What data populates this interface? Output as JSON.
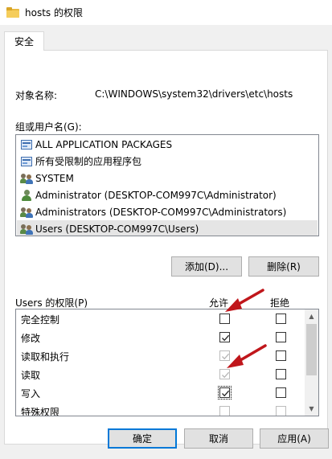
{
  "window": {
    "title": "hosts 的权限",
    "icon": "folder-icon"
  },
  "tabs": [
    {
      "label": "安全",
      "active": true
    }
  ],
  "object": {
    "label": "对象名称:",
    "value": "C:\\WINDOWS\\system32\\drivers\\etc\\hosts"
  },
  "groups": {
    "label": "组或用户名(G):",
    "items": [
      {
        "name": "ALL APPLICATION PACKAGES",
        "icon": "package-icon",
        "selected": false
      },
      {
        "name": "所有受限制的应用程序包",
        "icon": "package-icon",
        "selected": false
      },
      {
        "name": "SYSTEM",
        "icon": "group-icon",
        "selected": false
      },
      {
        "name": "Administrator (DESKTOP-COM997C\\Administrator)",
        "icon": "user-icon",
        "selected": false
      },
      {
        "name": "Administrators (DESKTOP-COM997C\\Administrators)",
        "icon": "group-icon",
        "selected": false
      },
      {
        "name": "Users (DESKTOP-COM997C\\Users)",
        "icon": "group-icon",
        "selected": true
      }
    ],
    "add_button": "添加(D)...",
    "remove_button": "删除(R)"
  },
  "permissions": {
    "label": "Users 的权限(P)",
    "allow_header": "允许",
    "deny_header": "拒绝",
    "rows": [
      {
        "name": "完全控制",
        "allow": false,
        "allow_disabled": false,
        "deny": false,
        "deny_disabled": false
      },
      {
        "name": "修改",
        "allow": true,
        "allow_disabled": false,
        "deny": false,
        "deny_disabled": false
      },
      {
        "name": "读取和执行",
        "allow": true,
        "allow_disabled": true,
        "deny": false,
        "deny_disabled": false
      },
      {
        "name": "读取",
        "allow": true,
        "allow_disabled": true,
        "deny": false,
        "deny_disabled": false
      },
      {
        "name": "写入",
        "allow": true,
        "allow_disabled": false,
        "deny": false,
        "deny_disabled": false
      },
      {
        "name": "特殊权限",
        "allow": false,
        "allow_disabled": true,
        "deny": false,
        "deny_disabled": true
      }
    ]
  },
  "footer": {
    "ok": "确定",
    "cancel": "取消",
    "apply": "应用(A)"
  },
  "colors": {
    "accent": "#0078d7",
    "annotation_arrow": "#c0161b",
    "selection": "#e5e5e5"
  }
}
